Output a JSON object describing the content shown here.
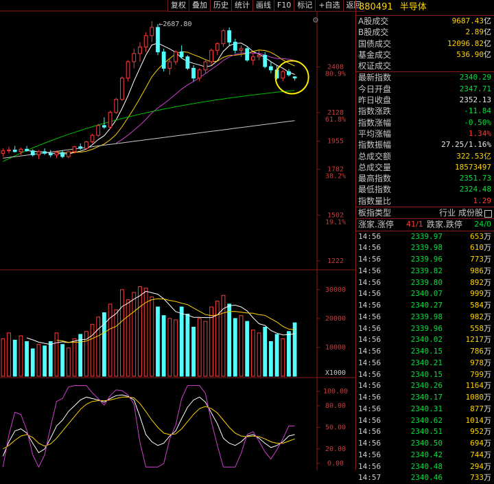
{
  "toolbar": [
    "复权",
    "叠加",
    "历史",
    "统计",
    "画线",
    "F10",
    "标记",
    "+自选",
    "返回"
  ],
  "header": {
    "code": "880491",
    "name": "半导体"
  },
  "stats_top": [
    {
      "label": "A股成交",
      "value": "9687.43",
      "unit": "亿",
      "color": "y"
    },
    {
      "label": "B股成交",
      "value": "2.89",
      "unit": "亿",
      "color": "y"
    },
    {
      "label": "国债成交",
      "value": "12096.82",
      "unit": "亿",
      "color": "y"
    },
    {
      "label": "基金成交",
      "value": "536.90",
      "unit": "亿",
      "color": "y"
    },
    {
      "label": "权证成交",
      "value": "",
      "unit": "",
      "color": "y"
    }
  ],
  "stats_main": [
    {
      "label": "最新指数",
      "value": "2340.29",
      "color": "g"
    },
    {
      "label": "今日开盘",
      "value": "2347.71",
      "color": "g"
    },
    {
      "label": "昨日收盘",
      "value": "2352.13",
      "color": "w"
    },
    {
      "label": "指数涨跌",
      "value": "-11.84",
      "color": "g"
    },
    {
      "label": "指数涨幅",
      "value": "-0.50%",
      "color": "g"
    },
    {
      "label": "平均涨幅",
      "value": "1.34%",
      "color": "r"
    },
    {
      "label": "指数振幅",
      "value": "27.25/1.16%",
      "color": "w"
    },
    {
      "label": "总成交额",
      "value": "322.53亿",
      "color": "y"
    },
    {
      "label": "总成交量",
      "value": "18573497",
      "color": "y"
    },
    {
      "label": "最高指数",
      "value": "2351.73",
      "color": "g"
    },
    {
      "label": "最低指数",
      "value": "2324.48",
      "color": "g"
    },
    {
      "label": "指数量比",
      "value": "1.29",
      "color": "r"
    }
  ],
  "board": {
    "label": "板指类型",
    "value": "行业 成份股"
  },
  "updown": {
    "up_label": "涨家.涨停",
    "up_value": "41/1",
    "down_label": "跌家.跌停",
    "down_value": "24/0"
  },
  "trades": [
    {
      "time": "14:56",
      "price": "2339.97",
      "vol": "653",
      "unit": "万",
      "color": "g"
    },
    {
      "time": "14:56",
      "price": "2339.98",
      "vol": "610",
      "unit": "万",
      "color": "g"
    },
    {
      "time": "14:56",
      "price": "2339.96",
      "vol": "773",
      "unit": "万",
      "color": "g"
    },
    {
      "time": "14:56",
      "price": "2339.82",
      "vol": "986",
      "unit": "万",
      "color": "g"
    },
    {
      "time": "14:56",
      "price": "2339.80",
      "vol": "892",
      "unit": "万",
      "color": "g"
    },
    {
      "time": "14:56",
      "price": "2340.07",
      "vol": "999",
      "unit": "万",
      "color": "g"
    },
    {
      "time": "14:56",
      "price": "2340.27",
      "vol": "584",
      "unit": "万",
      "color": "g"
    },
    {
      "time": "14:56",
      "price": "2339.98",
      "vol": "982",
      "unit": "万",
      "color": "g"
    },
    {
      "time": "14:56",
      "price": "2339.96",
      "vol": "558",
      "unit": "万",
      "color": "g"
    },
    {
      "time": "14:56",
      "price": "2340.02",
      "vol": "1217",
      "unit": "万",
      "color": "g"
    },
    {
      "time": "14:56",
      "price": "2340.15",
      "vol": "786",
      "unit": "万",
      "color": "g"
    },
    {
      "time": "14:56",
      "price": "2340.21",
      "vol": "978",
      "unit": "万",
      "color": "g"
    },
    {
      "time": "14:56",
      "price": "2340.15",
      "vol": "799",
      "unit": "万",
      "color": "g"
    },
    {
      "time": "14:56",
      "price": "2340.26",
      "vol": "1164",
      "unit": "万",
      "color": "g"
    },
    {
      "time": "14:56",
      "price": "2340.17",
      "vol": "1080",
      "unit": "万",
      "color": "g"
    },
    {
      "time": "14:56",
      "price": "2340.31",
      "vol": "877",
      "unit": "万",
      "color": "g"
    },
    {
      "time": "14:56",
      "price": "2340.62",
      "vol": "1014",
      "unit": "万",
      "color": "g"
    },
    {
      "time": "14:56",
      "price": "2340.51",
      "vol": "952",
      "unit": "万",
      "color": "g"
    },
    {
      "time": "14:56",
      "price": "2340.50",
      "vol": "694",
      "unit": "万",
      "color": "g"
    },
    {
      "time": "14:56",
      "price": "2340.42",
      "vol": "744",
      "unit": "万",
      "color": "g"
    },
    {
      "time": "14:56",
      "price": "2340.48",
      "vol": "294",
      "unit": "万",
      "color": "g"
    },
    {
      "time": "14:57",
      "price": "2340.46",
      "vol": "733",
      "unit": "万",
      "color": "g"
    }
  ],
  "chart_data": {
    "type": "candlestick",
    "price_axis": {
      "ticks": [
        2408,
        2128,
        1955,
        1782,
        1502,
        1222
      ],
      "fib_labels": [
        {
          "value": 2408,
          "label": "80.9%"
        },
        {
          "value": 2128,
          "label": "61.8%"
        },
        {
          "value": 1782,
          "label": "38.2%"
        },
        {
          "value": 1502,
          "label": "19.1%"
        }
      ]
    },
    "peak_annotation": "2687.80",
    "volume_axis": {
      "ticks": [
        30000,
        20000,
        10000
      ],
      "unit_label": "X1000"
    },
    "kdj_axis": {
      "ticks": [
        100.0,
        80.0,
        50.0,
        20.0,
        0.0
      ]
    },
    "candles": [
      [
        1880,
        1910,
        1860,
        1895
      ],
      [
        1895,
        1920,
        1880,
        1900
      ],
      [
        1900,
        1925,
        1885,
        1890
      ],
      [
        1890,
        1915,
        1870,
        1905
      ],
      [
        1905,
        1925,
        1890,
        1895
      ],
      [
        1895,
        1905,
        1860,
        1870
      ],
      [
        1870,
        1900,
        1845,
        1890
      ],
      [
        1890,
        1910,
        1870,
        1880
      ],
      [
        1880,
        1900,
        1855,
        1870
      ],
      [
        1870,
        1895,
        1850,
        1885
      ],
      [
        1885,
        1900,
        1850,
        1860
      ],
      [
        1860,
        1895,
        1850,
        1890
      ],
      [
        1890,
        1925,
        1880,
        1920
      ],
      [
        1920,
        1940,
        1900,
        1910
      ],
      [
        1910,
        1955,
        1900,
        1950
      ],
      [
        1950,
        2000,
        1940,
        1990
      ],
      [
        1990,
        2060,
        1980,
        2050
      ],
      [
        2050,
        2100,
        2030,
        2040
      ],
      [
        2040,
        2140,
        2030,
        2130
      ],
      [
        2130,
        2220,
        2120,
        2210
      ],
      [
        2210,
        2350,
        2200,
        2340
      ],
      [
        2340,
        2450,
        2320,
        2440
      ],
      [
        2440,
        2520,
        2400,
        2490
      ],
      [
        2490,
        2560,
        2440,
        2530
      ],
      [
        2530,
        2620,
        2500,
        2600
      ],
      [
        2600,
        2688,
        2560,
        2650
      ],
      [
        2650,
        2670,
        2480,
        2500
      ],
      [
        2500,
        2520,
        2380,
        2400
      ],
      [
        2400,
        2460,
        2360,
        2440
      ],
      [
        2440,
        2510,
        2420,
        2500
      ],
      [
        2500,
        2540,
        2460,
        2470
      ],
      [
        2470,
        2480,
        2390,
        2400
      ],
      [
        2400,
        2420,
        2320,
        2340
      ],
      [
        2340,
        2400,
        2320,
        2390
      ],
      [
        2390,
        2450,
        2370,
        2440
      ],
      [
        2440,
        2520,
        2420,
        2510
      ],
      [
        2510,
        2560,
        2480,
        2550
      ],
      [
        2550,
        2640,
        2530,
        2630
      ],
      [
        2630,
        2650,
        2540,
        2560
      ],
      [
        2560,
        2580,
        2490,
        2510
      ],
      [
        2510,
        2540,
        2470,
        2520
      ],
      [
        2520,
        2530,
        2440,
        2450
      ],
      [
        2450,
        2490,
        2420,
        2470
      ],
      [
        2470,
        2510,
        2450,
        2480
      ],
      [
        2480,
        2500,
        2400,
        2410
      ],
      [
        2410,
        2440,
        2370,
        2390
      ],
      [
        2390,
        2420,
        2330,
        2340
      ],
      [
        2340,
        2390,
        2320,
        2380
      ],
      [
        2380,
        2395,
        2350,
        2360
      ],
      [
        2347.71,
        2351.73,
        2324.48,
        2340.29
      ]
    ],
    "volume": [
      13000,
      15000,
      12500,
      14000,
      12000,
      9500,
      11000,
      10500,
      12000,
      15000,
      11000,
      9800,
      13000,
      14500,
      15500,
      18000,
      20500,
      22000,
      25000,
      23000,
      30000,
      26500,
      29000,
      31000,
      30500,
      27500,
      24000,
      21000,
      20000,
      19500,
      24000,
      21500,
      17000,
      20000,
      19000,
      24000,
      26000,
      28000,
      25000,
      20000,
      21000,
      19000,
      16000,
      15000,
      17000,
      12000,
      14500,
      13000,
      15500,
      18500
    ],
    "ma": [
      {
        "name": "MA5",
        "color": "#ffffff"
      },
      {
        "name": "MA10",
        "color": "#ffd400"
      },
      {
        "name": "MA20",
        "color": "#d040d0"
      },
      {
        "name": "MA60",
        "color": "#00c000"
      },
      {
        "name": "MA120",
        "color": "#c8c8c8"
      }
    ],
    "kdj": {
      "K": [
        10,
        30,
        45,
        48,
        42,
        28,
        15,
        20,
        35,
        52,
        60,
        72,
        80,
        88,
        92,
        90,
        88,
        85,
        90,
        94,
        95,
        93,
        88,
        65,
        40,
        30,
        25,
        28,
        38,
        45,
        62,
        78,
        88,
        92,
        85,
        70,
        55,
        35,
        28,
        25,
        30,
        38,
        40,
        35,
        28,
        22,
        25,
        30,
        38,
        40
      ],
      "D": [
        20,
        25,
        32,
        38,
        40,
        36,
        28,
        24,
        27,
        35,
        45,
        55,
        65,
        75,
        82,
        86,
        87,
        87,
        88,
        90,
        92,
        92,
        91,
        83,
        72,
        60,
        50,
        42,
        40,
        41,
        48,
        58,
        68,
        76,
        79,
        76,
        70,
        60,
        50,
        42,
        38,
        37,
        38,
        37,
        34,
        30,
        28,
        28,
        31,
        34
      ],
      "J": [
        -10,
        40,
        71,
        68,
        46,
        12,
        -11,
        12,
        51,
        86,
        90,
        106,
        110,
        114,
        112,
        98,
        90,
        81,
        94,
        102,
        101,
        95,
        82,
        29,
        -24,
        -30,
        -25,
        0,
        34,
        53,
        90,
        118,
        128,
        124,
        97,
        58,
        25,
        -15,
        -16,
        -9,
        14,
        40,
        44,
        31,
        16,
        6,
        19,
        34,
        52,
        52
      ]
    },
    "highlight": "circle around last candles"
  }
}
